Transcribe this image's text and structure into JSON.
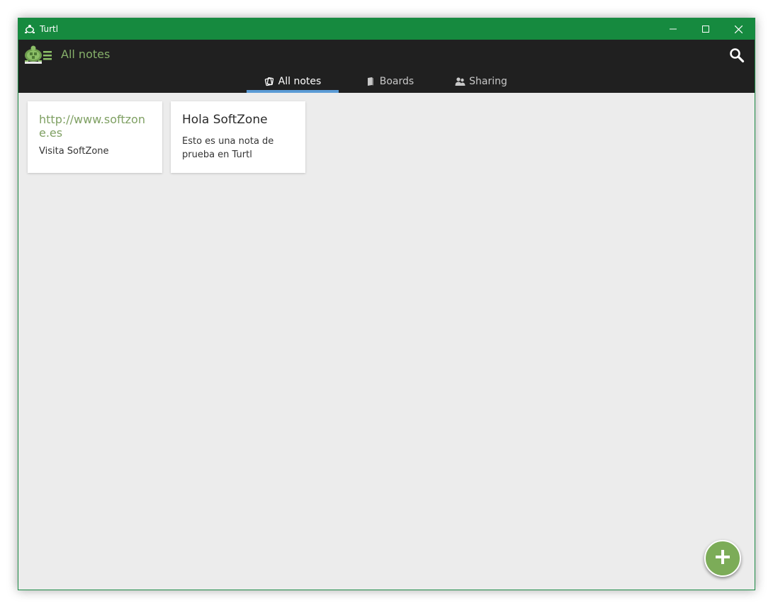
{
  "window": {
    "title": "Turtl",
    "controls": [
      "minimize-icon",
      "maximize-icon",
      "close-icon"
    ]
  },
  "header": {
    "title": "All notes",
    "logo_icon": "turtle-menu-icon",
    "search_icon": "search-icon"
  },
  "tabs": [
    {
      "label": "All notes",
      "icon": "notes-icon",
      "active": true
    },
    {
      "label": "Boards",
      "icon": "board-icon",
      "active": false
    },
    {
      "label": "Sharing",
      "icon": "people-icon",
      "active": false
    }
  ],
  "notes": [
    {
      "link": "http://www.softzone.es",
      "text": "Visita SoftZone"
    },
    {
      "title": "Hola SoftZone",
      "text": "Esto es una nota de prueba en Turtl"
    }
  ],
  "fab": {
    "icon": "plus-icon"
  },
  "colors": {
    "titlebar": "#168a3f",
    "appbar": "#202020",
    "accent_green": "#86b06a",
    "tab_indicator": "#5b9bd5",
    "fab": "#7cac58"
  }
}
